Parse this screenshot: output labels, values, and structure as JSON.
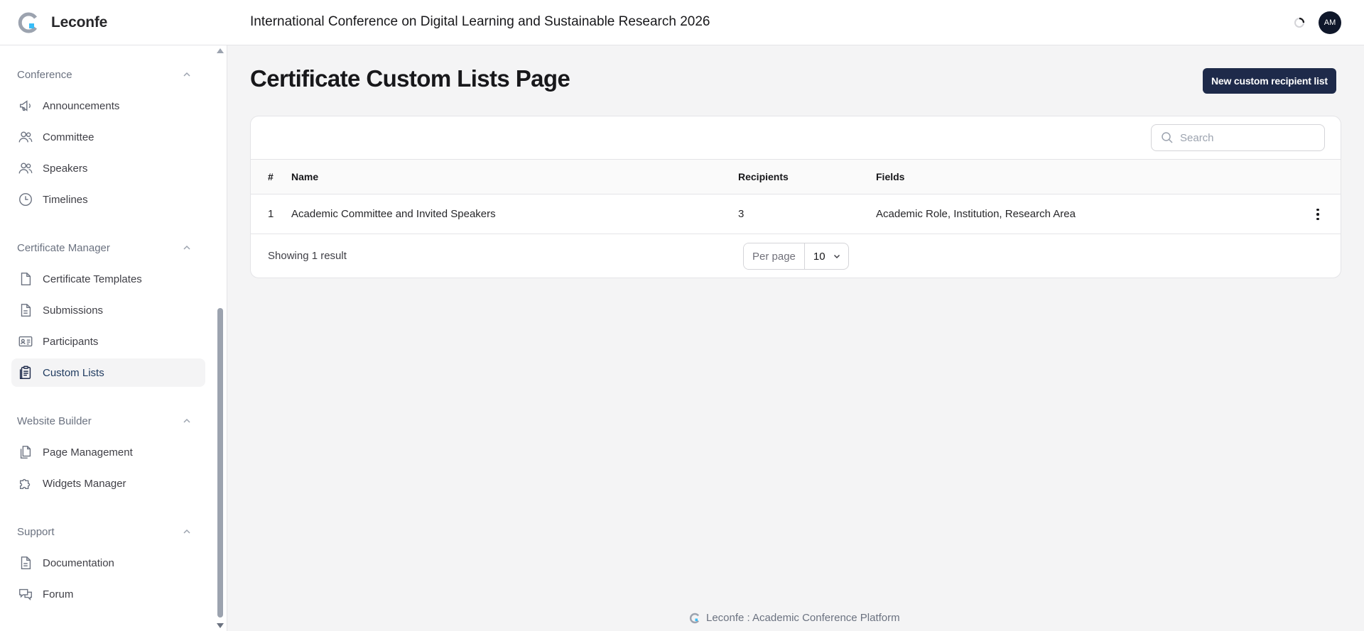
{
  "app": {
    "brand": "Leconfe",
    "conference_title": "International Conference on Digital Learning and Sustainable Research 2026",
    "user_initials": "AM"
  },
  "colors": {
    "primary": "#1e2a4a",
    "logo_gray": "#9ca3af",
    "logo_accent": "#38bdf8",
    "background": "#f4f4f5"
  },
  "sidebar": {
    "groups": [
      {
        "label": "Conference",
        "items": [
          {
            "label": "Announcements",
            "icon": "megaphone-icon"
          },
          {
            "label": "Committee",
            "icon": "users-icon"
          },
          {
            "label": "Speakers",
            "icon": "users-icon"
          },
          {
            "label": "Timelines",
            "icon": "clock-icon"
          }
        ]
      },
      {
        "label": "Certificate Manager",
        "items": [
          {
            "label": "Certificate Templates",
            "icon": "document-icon"
          },
          {
            "label": "Submissions",
            "icon": "document-text-icon"
          },
          {
            "label": "Participants",
            "icon": "id-card-icon"
          },
          {
            "label": "Custom Lists",
            "icon": "clipboard-list-icon",
            "active": true
          }
        ]
      },
      {
        "label": "Website Builder",
        "items": [
          {
            "label": "Page Management",
            "icon": "documents-icon"
          },
          {
            "label": "Widgets Manager",
            "icon": "puzzle-icon"
          }
        ]
      },
      {
        "label": "Support",
        "items": [
          {
            "label": "Documentation",
            "icon": "document-text-icon"
          },
          {
            "label": "Forum",
            "icon": "chat-icon"
          }
        ]
      }
    ]
  },
  "main": {
    "title": "Certificate Custom Lists Page",
    "new_button": "New custom recipient list",
    "search_placeholder": "Search",
    "table": {
      "columns": [
        "#",
        "Name",
        "Recipients",
        "Fields"
      ],
      "rows": [
        {
          "index": "1",
          "name": "Academic Committee and Invited Speakers",
          "recipients": "3",
          "fields": "Academic Role, Institution, Research Area"
        }
      ]
    },
    "showing": "Showing 1 result",
    "per_page_label": "Per page",
    "per_page_value": "10"
  },
  "footer": {
    "text": "Leconfe : Academic Conference Platform"
  }
}
